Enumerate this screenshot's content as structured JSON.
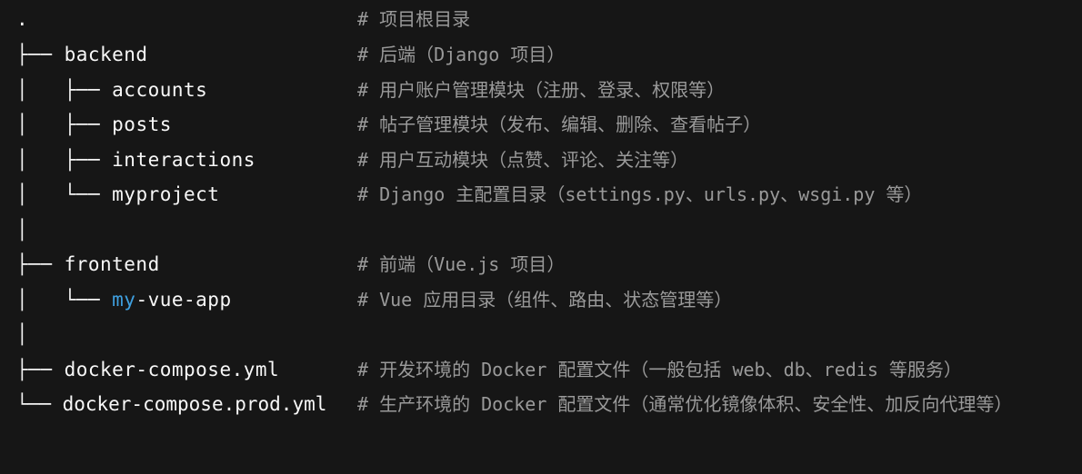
{
  "lines": [
    {
      "prefix": ".",
      "name": "",
      "comment": "# 项目根目录"
    },
    {
      "prefix": "├── ",
      "name": "backend",
      "comment": "# 后端（Django 项目）"
    },
    {
      "prefix": "│   ├── ",
      "name": "accounts",
      "comment": "# 用户账户管理模块（注册、登录、权限等）"
    },
    {
      "prefix": "│   ├── ",
      "name": "posts",
      "comment": "# 帖子管理模块（发布、编辑、删除、查看帖子）"
    },
    {
      "prefix": "│   ├── ",
      "name": "interactions",
      "comment": "# 用户互动模块（点赞、评论、关注等）"
    },
    {
      "prefix": "│   └── ",
      "name": "myproject",
      "comment": "# Django 主配置目录（settings.py、urls.py、wsgi.py 等）"
    },
    {
      "prefix": "│",
      "name": "",
      "comment": ""
    },
    {
      "prefix": "├── ",
      "name": "frontend",
      "comment": "# 前端（Vue.js 项目）"
    },
    {
      "prefix": "│   └── ",
      "name_highlight": "my",
      "name": "-vue-app",
      "comment": "# Vue 应用目录（组件、路由、状态管理等）"
    },
    {
      "prefix": "│",
      "name": "",
      "comment": ""
    },
    {
      "prefix": "├── ",
      "name": "docker-compose.yml",
      "comment": "# 开发环境的 Docker 配置文件（一般包括 web、db、redis 等服务）"
    },
    {
      "prefix": "└── ",
      "name": "docker-compose.prod.yml",
      "comment": "# 生产环境的 Docker 配置文件（通常优化镜像体积、安全性、加反向代理等）"
    }
  ],
  "colors": {
    "background": "#161616",
    "text": "#f3f3f3",
    "comment": "#9a9a9a",
    "highlight": "#3fa0e0"
  }
}
